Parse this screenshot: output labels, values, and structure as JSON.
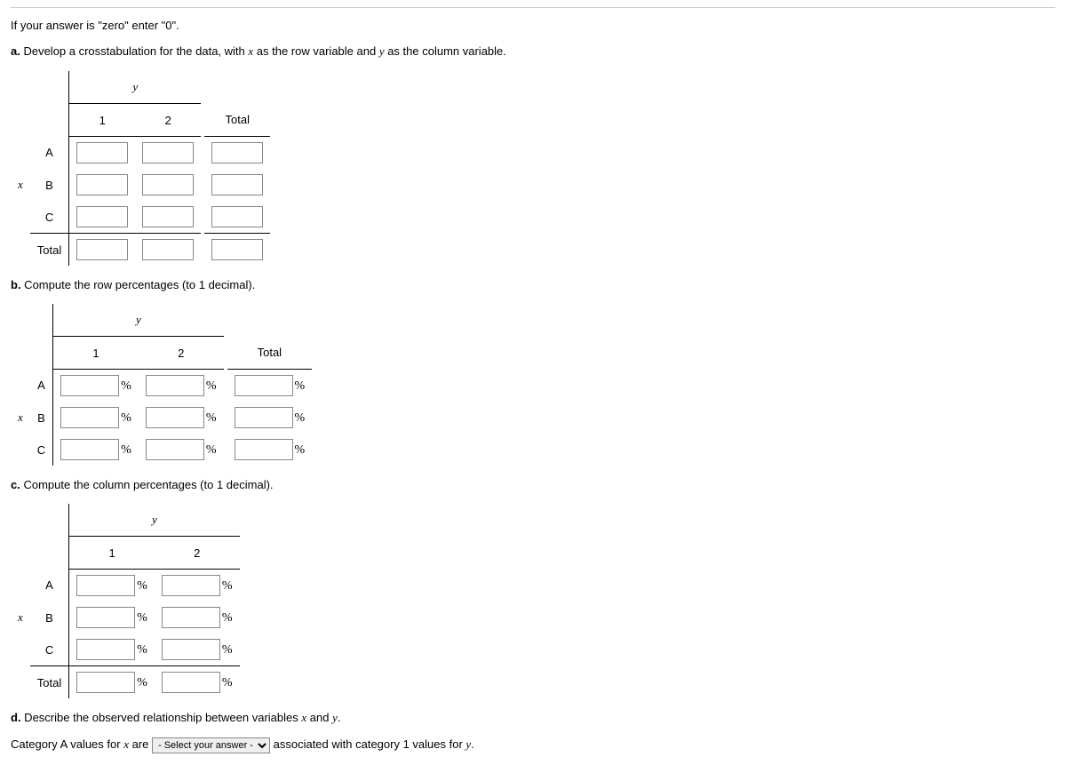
{
  "intro": {
    "line1_pre": "If your answer is \"zero\" enter \"0\".",
    "partA_label": "a.",
    "partA_text_1": " Develop a crosstabulation for the data, with ",
    "partA_text_2": " as the row variable and ",
    "partA_text_3": " as the column variable.",
    "partB_label": "b.",
    "partB_text": " Compute the row percentages (to 1 decimal).",
    "partC_label": "c.",
    "partC_text": " Compute the column percentages (to 1 decimal).",
    "partD_label": "d.",
    "partD_text_1": " Describe the observed relationship between variables ",
    "partD_text_2": " and ",
    "partD_text_3": ".",
    "conclusion_1": "Category A values for ",
    "conclusion_2": " are ",
    "conclusion_3": " associated with category 1 values for ",
    "conclusion_4": "."
  },
  "vars": {
    "x": "x",
    "y": "y"
  },
  "headers": {
    "col1": "1",
    "col2": "2",
    "total": "Total",
    "rowA": "A",
    "rowB": "B",
    "rowC": "C",
    "rowTotal": "Total"
  },
  "pct": "%",
  "select": {
    "placeholder": "- Select your answer -"
  }
}
